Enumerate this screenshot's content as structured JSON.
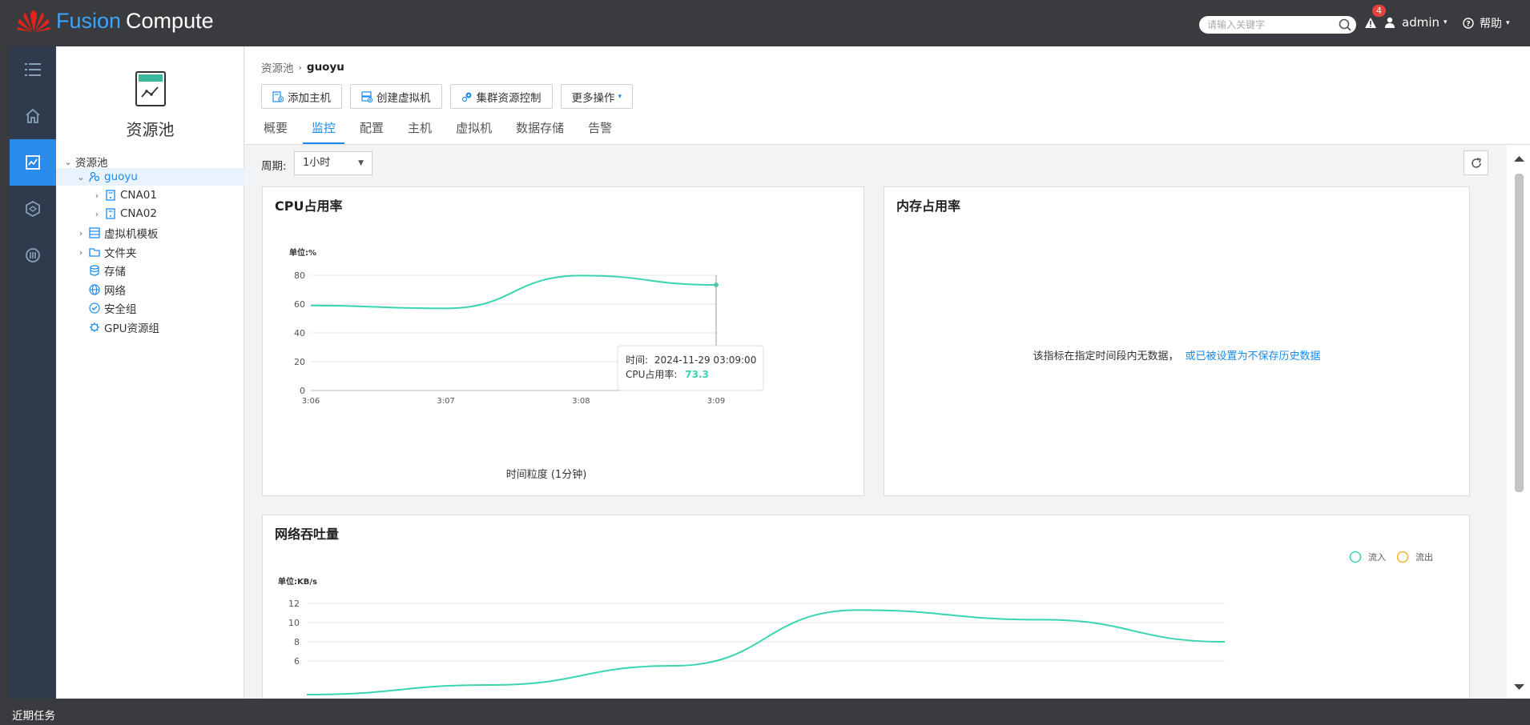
{
  "app": {
    "logo_fusion": "Fusion",
    "logo_compute": "Compute",
    "search_placeholder": "请输入关键字",
    "alarm_count": "4",
    "user": "admin",
    "help": "帮助"
  },
  "rail": {
    "icons": [
      "list-icon",
      "home-icon",
      "resource-pool-icon",
      "network-icon",
      "gpu-icon"
    ],
    "active_index": 2
  },
  "tree": {
    "title": "资源池",
    "items": [
      {
        "label": "资源池",
        "arrow": "v",
        "icon": "none"
      },
      {
        "label": "guoyu",
        "arrow": "v",
        "icon": "cluster-icon",
        "selected": true
      },
      {
        "label": "CNA01",
        "arrow": ">",
        "icon": "host-icon"
      },
      {
        "label": "CNA02",
        "arrow": ">",
        "icon": "host-icon"
      },
      {
        "label": "虚拟机模板",
        "arrow": ">",
        "icon": "template-icon"
      },
      {
        "label": "文件夹",
        "arrow": ">",
        "icon": "folder-icon"
      },
      {
        "label": "存储",
        "arrow": "",
        "icon": "storage-icon"
      },
      {
        "label": "网络",
        "arrow": "",
        "icon": "network-icon"
      },
      {
        "label": "安全组",
        "arrow": "",
        "icon": "security-group-icon"
      },
      {
        "label": "GPU资源组",
        "arrow": "",
        "icon": "gpu-group-icon"
      }
    ]
  },
  "main": {
    "breadcrumb_root": "资源池",
    "breadcrumb_current": "guoyu",
    "toolbar": {
      "add_host": "添加主机",
      "create_vm": "创建虚拟机",
      "cluster_control": "集群资源控制",
      "more": "更多操作"
    },
    "tabs": [
      "概要",
      "监控",
      "配置",
      "主机",
      "虚拟机",
      "数据存储",
      "告警"
    ],
    "active_tab": 1,
    "period_label": "周期:",
    "period_value": "1小时",
    "cpu_card": {
      "title": "CPU占用率",
      "unit": "单位:%",
      "xlabel": "时间粒度 (1分钟)",
      "tooltip_time_label": "时间:",
      "tooltip_time": "2024-11-29 03:09:00",
      "tooltip_value_label": "CPU占用率:",
      "tooltip_value": "73.3"
    },
    "mem_card": {
      "title": "内存占用率",
      "nodata_text": "该指标在指定时间段内无数据，",
      "nodata_link": "或已被设置为不保存历史数据"
    },
    "net_card": {
      "title": "网络吞吐量",
      "unit": "单位:KB/s",
      "legend_in": "流入",
      "legend_out": "流出"
    }
  },
  "bottom": {
    "recent_tasks": "近期任务"
  },
  "colors": {
    "accent": "#1a8cf0",
    "line": "#3ad4b0",
    "out_line": "#f5b731",
    "topbar": "#3a3b3e",
    "rail": "#2f3b4c"
  },
  "chart_data": [
    {
      "type": "line",
      "title": "CPU占用率",
      "ylabel": "单位:%",
      "xlabel": "时间粒度 (1分钟)",
      "categories": [
        "3:06",
        "3:07",
        "3:08",
        "3:09"
      ],
      "y_ticks": [
        "0",
        "20",
        "40",
        "60",
        "80"
      ],
      "ylim": [
        0,
        80
      ],
      "series": [
        {
          "values": [
            59,
            57,
            79.8,
            73.3
          ]
        }
      ]
    },
    {
      "type": "line",
      "title": "网络吞吐量",
      "ylabel": "单位:KB/s",
      "y_ticks": [
        "6",
        "8",
        "10",
        "12"
      ],
      "ylim": [
        6,
        12
      ],
      "legend": "top-right",
      "series": [
        {
          "name": "流入",
          "values": [
            2.5,
            3.5,
            5.5,
            11.3,
            10.3,
            8.0
          ]
        },
        {
          "name": "流出",
          "values": []
        }
      ]
    }
  ]
}
